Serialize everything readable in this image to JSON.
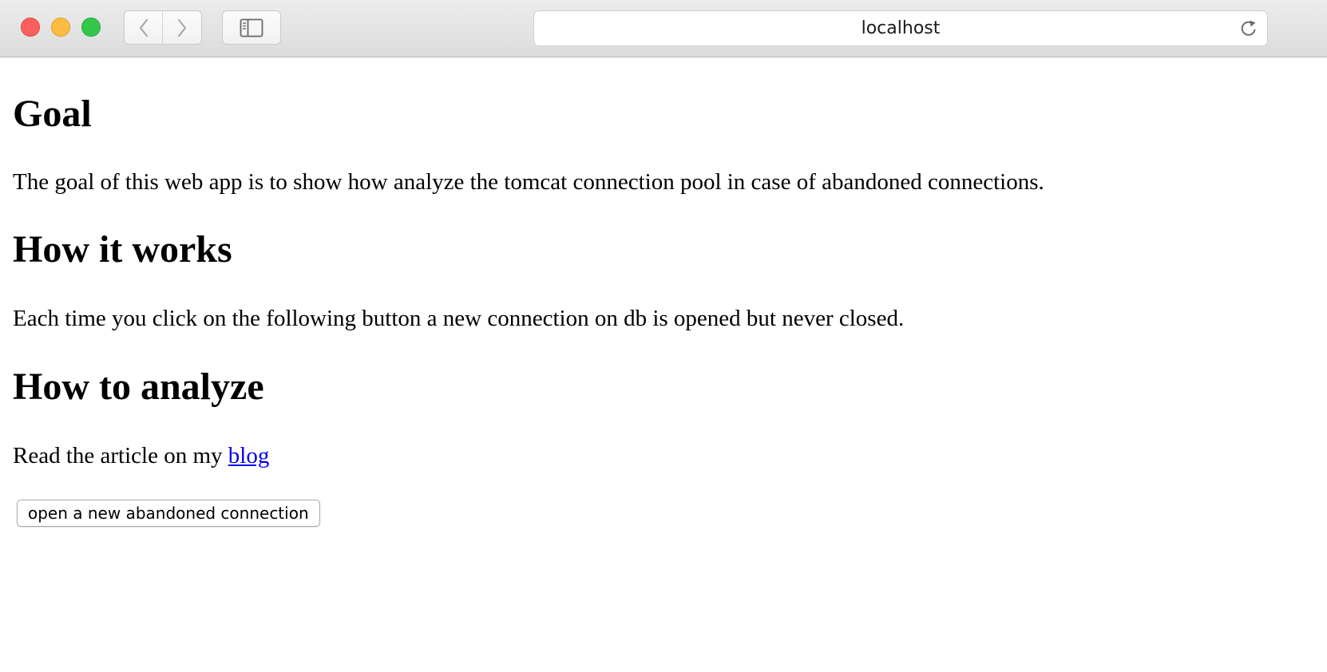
{
  "browser": {
    "address": "localhost",
    "icons": {
      "back": "chevron-left-icon",
      "forward": "chevron-right-icon",
      "sidebar": "sidebar-icon",
      "reload": "reload-icon"
    },
    "traffic_colors": {
      "close": "#fc605c",
      "minimize": "#fdbc40",
      "zoom": "#34c84a"
    }
  },
  "page": {
    "sections": [
      {
        "heading": "Goal",
        "text": "The goal of this web app is to show how analyze the tomcat connection pool in case of abandoned connections."
      },
      {
        "heading": "How it works",
        "text": "Each time you click on the following button a new connection on db is opened but never closed."
      },
      {
        "heading": "How to analyze",
        "text": "Read the article on my ",
        "link_text": "blog"
      }
    ],
    "button_label": "open a new abandoned connection",
    "link_color": "#0000ee"
  }
}
